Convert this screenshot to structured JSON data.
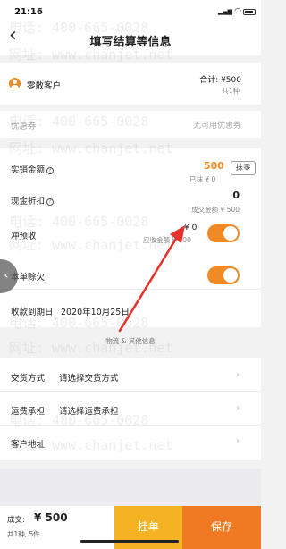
{
  "status_bar": {
    "time": "21:16",
    "signal": "▂▄▆",
    "wifi": "◠"
  },
  "nav": {
    "back_glyph": "‹",
    "title": "填写结算等信息"
  },
  "customer": {
    "name": "零散客户",
    "total_label": "合计: ¥500",
    "count_label": "共1种"
  },
  "coupon": {
    "label": "优惠券",
    "value": "无可用优惠券"
  },
  "actual_amount": {
    "label": "实销金额",
    "help": "?",
    "value": "500",
    "sub": "已抹 ¥ 0",
    "button": "抹零"
  },
  "cash_discount": {
    "label": "现金折扣",
    "help": "?",
    "value": "0",
    "sub": "成交金额 ¥ 500"
  },
  "prepay_offset": {
    "label": "冲预收",
    "value": "¥ 0",
    "sub": "应收金额 ¥ 500",
    "enabled": true
  },
  "credit": {
    "label": "本单赊欠",
    "enabled": true
  },
  "due_date": {
    "label": "收款到期日",
    "value": "2020年10月25日"
  },
  "section_divider": "物流 & 其他信息",
  "delivery": {
    "label": "交货方式",
    "placeholder": "请选择交货方式"
  },
  "freight": {
    "label": "运费承担",
    "placeholder": "请选择运费承担"
  },
  "address": {
    "label": "客户地址"
  },
  "footer": {
    "deal_label": "成交:",
    "deal_amount": "¥ 500",
    "summary": "共1种, 5件",
    "hold_button": "挂单",
    "save_button": "保存"
  },
  "watermark": {
    "phone": "电话: 400-665-0028",
    "site": "网址: www.chanjet.net"
  },
  "colors": {
    "accent": "#f08a24",
    "hold": "#f5b324",
    "arrow": "#e8322b"
  },
  "icons": [
    "back-icon",
    "user-avatar-icon",
    "help-icon",
    "chevron-right-icon",
    "arrow-annotation-icon"
  ]
}
